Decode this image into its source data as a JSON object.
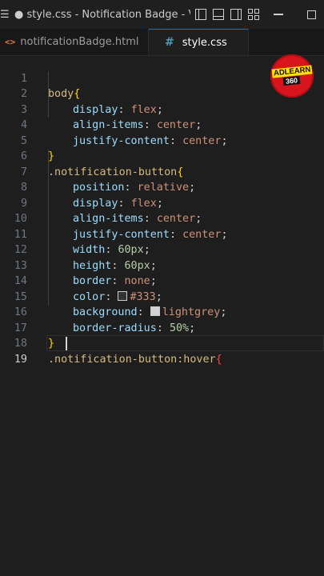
{
  "window": {
    "title": "● style.css - Notification Badge - Visu...",
    "menu_glyph": "☰"
  },
  "tabs": [
    {
      "label": "notificationBadge.html",
      "icon": "html-icon",
      "active": false
    },
    {
      "label": "style.css",
      "icon": "css-icon",
      "active": true,
      "dirty": true
    }
  ],
  "logo": {
    "top": "ADLEARN",
    "bottom": "360"
  },
  "editor": {
    "line_numbers": [
      "1",
      "2",
      "3",
      "4",
      "5",
      "6",
      "7",
      "8",
      "9",
      "10",
      "11",
      "12",
      "13",
      "14",
      "15",
      "16",
      "17",
      "18",
      "19"
    ],
    "lines": {
      "l1": {
        "sel": "body",
        "brace": "{"
      },
      "l2": {
        "prop": "display",
        "val": "flex"
      },
      "l3": {
        "prop": "align-items",
        "val": "center"
      },
      "l4": {
        "prop": "justify-content",
        "val": "center"
      },
      "l5": {
        "brace": "}"
      },
      "l6": {
        "sel": ".notification-button",
        "brace": "{"
      },
      "l7": {
        "prop": "position",
        "val": "relative"
      },
      "l8": {
        "prop": "display",
        "val": "flex"
      },
      "l9": {
        "prop": "align-items",
        "val": "center"
      },
      "l10": {
        "prop": "justify-content",
        "val": "center"
      },
      "l11": {
        "prop": "width",
        "val": "60px"
      },
      "l12": {
        "prop": "height",
        "val": "60px"
      },
      "l13": {
        "prop": "border",
        "val": "none"
      },
      "l14": {
        "prop": "color",
        "val": "#333",
        "swatch": "#333333"
      },
      "l15": {
        "prop": "background",
        "val": "lightgrey",
        "swatch": "#d3d3d3"
      },
      "l16": {
        "prop": "border-radius",
        "val": "50%"
      },
      "l17": {
        "brace": "}"
      },
      "l18": {
        "sel": ".notification-button:hover",
        "brace": "{"
      }
    },
    "punct": {
      "colon": ": ",
      "semi": ";"
    }
  }
}
